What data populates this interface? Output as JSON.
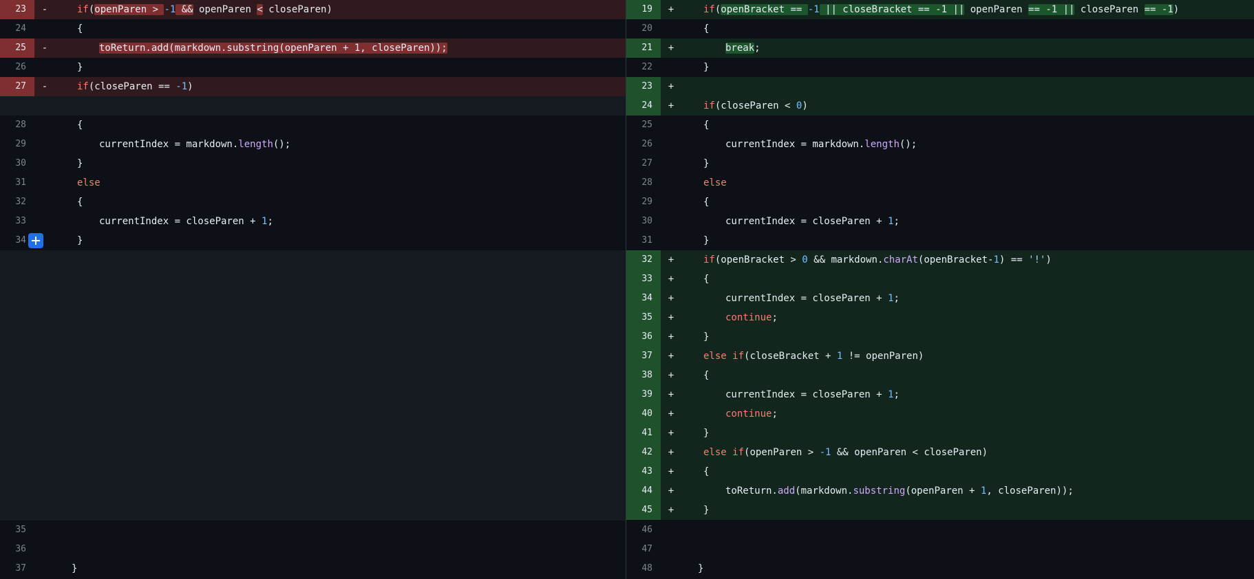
{
  "diff": {
    "left": {
      "lines": [
        {
          "num": "23",
          "type": "del",
          "marker": "-",
          "indent": 4,
          "tokens": [
            [
              "kw",
              "if"
            ],
            [
              "",
              "("
            ],
            [
              "hd",
              "openParen > "
            ],
            [
              "nm",
              "-1"
            ],
            [
              "",
              ""
            ],
            [
              "hd",
              " &&"
            ],
            [
              "",
              " openParen "
            ],
            [
              "hd",
              "<"
            ],
            [
              "",
              " closeParen)"
            ]
          ]
        },
        {
          "num": "24",
          "type": "ctx",
          "marker": "",
          "indent": 4,
          "tokens": [
            [
              "",
              "{"
            ]
          ]
        },
        {
          "num": "25",
          "type": "del",
          "marker": "-",
          "indent": 8,
          "tokens": [
            [
              "hd",
              "toReturn.add(markdown.substring(openParen + 1, closeParen));"
            ]
          ]
        },
        {
          "num": "26",
          "type": "ctx",
          "marker": "",
          "indent": 4,
          "tokens": [
            [
              "",
              "}"
            ]
          ]
        },
        {
          "num": "27",
          "type": "del",
          "marker": "-",
          "indent": 4,
          "tokens": [
            [
              "kw",
              "if"
            ],
            [
              "",
              "(closeParen == "
            ],
            [
              "nm",
              "-1"
            ],
            [
              "",
              ")"
            ]
          ]
        },
        {
          "num": "",
          "type": "blank",
          "marker": "",
          "indent": 0,
          "tokens": []
        },
        {
          "num": "28",
          "type": "ctx",
          "marker": "",
          "indent": 4,
          "tokens": [
            [
              "",
              "{"
            ]
          ]
        },
        {
          "num": "29",
          "type": "ctx",
          "marker": "",
          "indent": 8,
          "tokens": [
            [
              "",
              "currentIndex = markdown."
            ],
            [
              "fn",
              "length"
            ],
            [
              "",
              "();"
            ]
          ]
        },
        {
          "num": "30",
          "type": "ctx",
          "marker": "",
          "indent": 4,
          "tokens": [
            [
              "",
              "}"
            ]
          ]
        },
        {
          "num": "31",
          "type": "ctx",
          "marker": "",
          "indent": 4,
          "tokens": [
            [
              "kw",
              "else"
            ]
          ]
        },
        {
          "num": "32",
          "type": "ctx",
          "marker": "",
          "indent": 4,
          "tokens": [
            [
              "",
              "{"
            ]
          ]
        },
        {
          "num": "33",
          "type": "ctx",
          "marker": "",
          "indent": 8,
          "tokens": [
            [
              "",
              "currentIndex = closeParen + "
            ],
            [
              "nm",
              "1"
            ],
            [
              "",
              ";"
            ]
          ]
        },
        {
          "num": "34",
          "type": "ctx",
          "marker": "",
          "indent": 4,
          "tokens": [
            [
              "",
              "}"
            ]
          ]
        }
      ],
      "tail": [
        {
          "num": "35",
          "type": "ctx",
          "marker": "",
          "indent": 0,
          "tokens": []
        },
        {
          "num": "36",
          "type": "ctx",
          "marker": "",
          "indent": 0,
          "tokens": []
        },
        {
          "num": "37",
          "type": "ctx",
          "marker": "",
          "indent": 3,
          "tokens": [
            [
              "",
              "}"
            ]
          ]
        }
      ]
    },
    "right": {
      "lines": [
        {
          "num": "19",
          "type": "add",
          "marker": "+",
          "indent": 4,
          "tokens": [
            [
              "kw",
              "if"
            ],
            [
              "",
              "("
            ],
            [
              "ha",
              "openBracket == "
            ],
            [
              "nm",
              "-1"
            ],
            [
              "ha",
              " || closeBracket == -1 ||"
            ],
            [
              "",
              " openParen "
            ],
            [
              "ha",
              "== -1 ||"
            ],
            [
              "",
              " closeParen "
            ],
            [
              "ha",
              "== -1"
            ],
            [
              "",
              ")"
            ]
          ]
        },
        {
          "num": "20",
          "type": "ctx",
          "marker": "",
          "indent": 4,
          "tokens": [
            [
              "",
              "{"
            ]
          ]
        },
        {
          "num": "21",
          "type": "add",
          "marker": "+",
          "indent": 8,
          "tokens": [
            [
              "ha",
              "break"
            ],
            [
              "",
              ";"
            ]
          ]
        },
        {
          "num": "22",
          "type": "ctx",
          "marker": "",
          "indent": 4,
          "tokens": [
            [
              "",
              "}"
            ]
          ]
        },
        {
          "num": "23",
          "type": "add",
          "marker": "+",
          "indent": 0,
          "tokens": []
        },
        {
          "num": "24",
          "type": "add",
          "marker": "+",
          "indent": 4,
          "tokens": [
            [
              "kw",
              "if"
            ],
            [
              "",
              "(closeParen < "
            ],
            [
              "nm",
              "0"
            ],
            [
              "",
              ")"
            ]
          ]
        },
        {
          "num": "25",
          "type": "ctx",
          "marker": "",
          "indent": 4,
          "tokens": [
            [
              "",
              "{"
            ]
          ]
        },
        {
          "num": "26",
          "type": "ctx",
          "marker": "",
          "indent": 8,
          "tokens": [
            [
              "",
              "currentIndex = markdown."
            ],
            [
              "fn",
              "length"
            ],
            [
              "",
              "();"
            ]
          ]
        },
        {
          "num": "27",
          "type": "ctx",
          "marker": "",
          "indent": 4,
          "tokens": [
            [
              "",
              "}"
            ]
          ]
        },
        {
          "num": "28",
          "type": "ctx",
          "marker": "",
          "indent": 4,
          "tokens": [
            [
              "kw",
              "else"
            ]
          ]
        },
        {
          "num": "29",
          "type": "ctx",
          "marker": "",
          "indent": 4,
          "tokens": [
            [
              "",
              "{"
            ]
          ]
        },
        {
          "num": "30",
          "type": "ctx",
          "marker": "",
          "indent": 8,
          "tokens": [
            [
              "",
              "currentIndex = closeParen + "
            ],
            [
              "nm",
              "1"
            ],
            [
              "",
              ";"
            ]
          ]
        },
        {
          "num": "31",
          "type": "ctx",
          "marker": "",
          "indent": 4,
          "tokens": [
            [
              "",
              "}"
            ]
          ]
        },
        {
          "num": "32",
          "type": "add",
          "marker": "+",
          "indent": 4,
          "tokens": [
            [
              "kw",
              "if"
            ],
            [
              "",
              "(openBracket > "
            ],
            [
              "nm",
              "0"
            ],
            [
              "",
              " && markdown."
            ],
            [
              "fn",
              "charAt"
            ],
            [
              "",
              "(openBracket-"
            ],
            [
              "nm",
              "1"
            ],
            [
              "",
              ") == "
            ],
            [
              "st",
              "'!'"
            ],
            [
              "",
              ")"
            ]
          ]
        },
        {
          "num": "33",
          "type": "add",
          "marker": "+",
          "indent": 4,
          "tokens": [
            [
              "",
              "{"
            ]
          ]
        },
        {
          "num": "34",
          "type": "add",
          "marker": "+",
          "indent": 8,
          "tokens": [
            [
              "",
              "currentIndex = closeParen + "
            ],
            [
              "nm",
              "1"
            ],
            [
              "",
              ";"
            ]
          ]
        },
        {
          "num": "35",
          "type": "add",
          "marker": "+",
          "indent": 8,
          "tokens": [
            [
              "kw",
              "continue"
            ],
            [
              "",
              ";"
            ]
          ]
        },
        {
          "num": "36",
          "type": "add",
          "marker": "+",
          "indent": 4,
          "tokens": [
            [
              "",
              "}"
            ]
          ]
        },
        {
          "num": "37",
          "type": "add",
          "marker": "+",
          "indent": 4,
          "tokens": [
            [
              "kw",
              "else if"
            ],
            [
              "",
              "(closeBracket + "
            ],
            [
              "nm",
              "1"
            ],
            [
              "",
              " != openParen)"
            ]
          ]
        },
        {
          "num": "38",
          "type": "add",
          "marker": "+",
          "indent": 4,
          "tokens": [
            [
              "",
              "{"
            ]
          ]
        },
        {
          "num": "39",
          "type": "add",
          "marker": "+",
          "indent": 8,
          "tokens": [
            [
              "",
              "currentIndex = closeParen + "
            ],
            [
              "nm",
              "1"
            ],
            [
              "",
              ";"
            ]
          ]
        },
        {
          "num": "40",
          "type": "add",
          "marker": "+",
          "indent": 8,
          "tokens": [
            [
              "kw",
              "continue"
            ],
            [
              "",
              ";"
            ]
          ]
        },
        {
          "num": "41",
          "type": "add",
          "marker": "+",
          "indent": 4,
          "tokens": [
            [
              "",
              "}"
            ]
          ]
        },
        {
          "num": "42",
          "type": "add",
          "marker": "+",
          "indent": 4,
          "tokens": [
            [
              "kw",
              "else if"
            ],
            [
              "",
              "(openParen > "
            ],
            [
              "nm",
              "-1"
            ],
            [
              "",
              " && openParen < closeParen)"
            ]
          ]
        },
        {
          "num": "43",
          "type": "add",
          "marker": "+",
          "indent": 4,
          "tokens": [
            [
              "",
              "{"
            ]
          ]
        },
        {
          "num": "44",
          "type": "add",
          "marker": "+",
          "indent": 8,
          "tokens": [
            [
              "",
              "toReturn."
            ],
            [
              "fn",
              "add"
            ],
            [
              "",
              "(markdown."
            ],
            [
              "fn",
              "substring"
            ],
            [
              "",
              "(openParen + "
            ],
            [
              "nm",
              "1"
            ],
            [
              "",
              ", closeParen));"
            ]
          ]
        },
        {
          "num": "45",
          "type": "add",
          "marker": "+",
          "indent": 4,
          "tokens": [
            [
              "",
              "}"
            ]
          ]
        }
      ],
      "tail": [
        {
          "num": "46",
          "type": "ctx",
          "marker": "",
          "indent": 0,
          "tokens": []
        },
        {
          "num": "47",
          "type": "ctx",
          "marker": "",
          "indent": 0,
          "tokens": []
        },
        {
          "num": "48",
          "type": "ctx",
          "marker": "",
          "indent": 3,
          "tokens": [
            [
              "",
              "}"
            ]
          ]
        }
      ]
    },
    "expand_button_icon": "plus-icon",
    "colors": {
      "background": "#0d1117",
      "deletion": "#f85149",
      "addition": "#2ea043",
      "keyword": "#ff7b72",
      "number": "#79c0ff",
      "function": "#d2a8ff",
      "expand_button": "#1f6feb"
    }
  }
}
